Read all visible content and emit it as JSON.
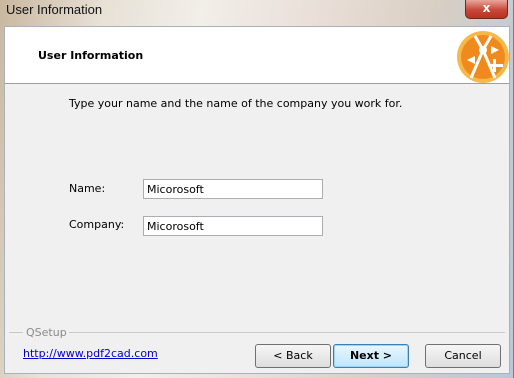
{
  "window": {
    "title": "User Information",
    "close_glyph": "x"
  },
  "header": {
    "title": "User Information",
    "logo_icon": "pdf2cad-compass-logo"
  },
  "instruction": "Type your name and the name of the company you work for.",
  "form": {
    "name_label": "Name:",
    "name_value": "Micorosoft",
    "company_label": "Company:",
    "company_value": "Micorosoft"
  },
  "footer": {
    "group_label": "QSetup",
    "link": "http://www.pdf2cad.com",
    "back_label": "< Back",
    "next_label": "Next >",
    "cancel_label": "Cancel"
  },
  "colors": {
    "close_button": "#c7483a",
    "link": "#0000cc",
    "logo_orange": "#f08a1d"
  }
}
